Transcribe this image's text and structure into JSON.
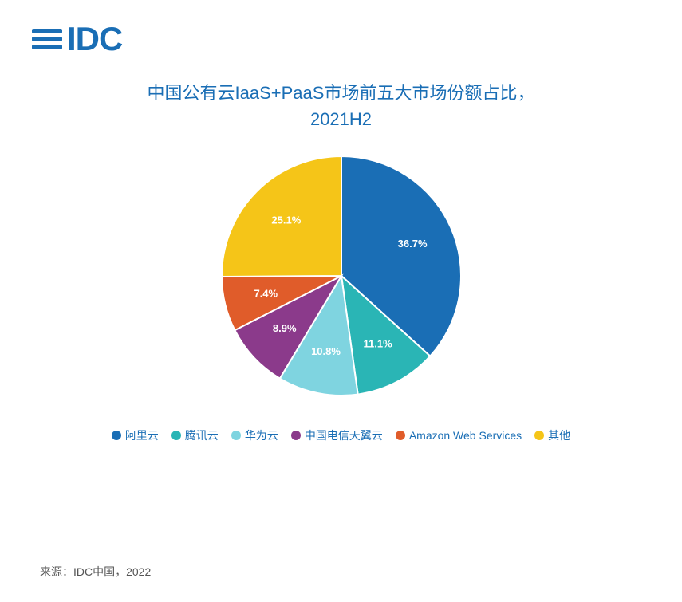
{
  "logo": {
    "text": "IDC"
  },
  "title": {
    "line1": "中国公有云IaaS+PaaS市场前五大市场份额占比，",
    "line2": "2021H2"
  },
  "chart": {
    "segments": [
      {
        "name": "阿里云",
        "value": 36.7,
        "color": "#1a6eb5",
        "label": "36.7%"
      },
      {
        "name": "腾讯云",
        "value": 11.1,
        "color": "#2ab5b5",
        "label": "11.1%"
      },
      {
        "name": "华为云",
        "value": 10.8,
        "color": "#7fd4e0",
        "label": "10.8%"
      },
      {
        "name": "中国电信天翼云",
        "value": 8.9,
        "color": "#8b3a8b",
        "label": "8.9%"
      },
      {
        "name": "Amazon Web Services",
        "value": 7.4,
        "color": "#e05c2a",
        "label": "7.4%"
      },
      {
        "name": "其他",
        "value": 25.1,
        "color": "#f5c518",
        "label": "25.1%"
      }
    ]
  },
  "legend": {
    "items": [
      {
        "name": "阿里云",
        "color": "#1a6eb5"
      },
      {
        "name": "腾讯云",
        "color": "#2ab5b5"
      },
      {
        "name": "华为云",
        "color": "#7fd4e0"
      },
      {
        "name": "中国电信天翼云",
        "color": "#8b3a8b"
      },
      {
        "name": "Amazon Web Services",
        "color": "#e05c2a"
      },
      {
        "name": "其他",
        "color": "#f5c518"
      }
    ]
  },
  "source": {
    "text": "来源：IDC中国，2022"
  }
}
